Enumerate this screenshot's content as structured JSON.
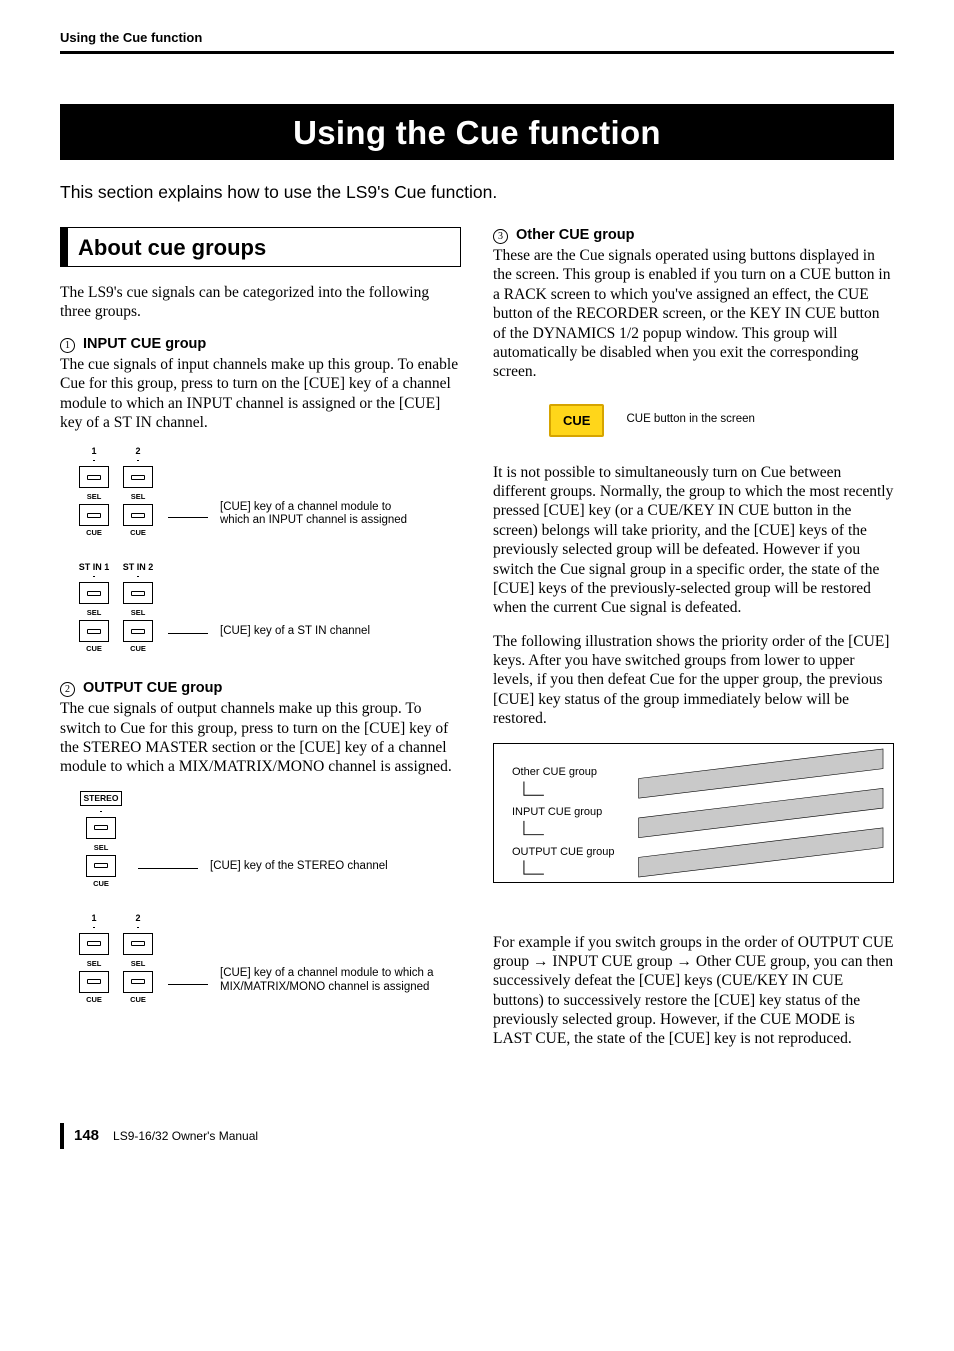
{
  "running_head": "Using the Cue function",
  "title": "Using the Cue function",
  "intro": "This section explains how to use the LS9's Cue function.",
  "section_heading": "About cue groups",
  "lead_para": "The LS9's cue signals can be categorized into the following three groups.",
  "groups": {
    "g1": {
      "num": "1",
      "heading": "INPUT CUE group",
      "para": "The cue signals of input channels make up this group. To enable Cue for this group, press to turn on the [CUE] key of a channel module to which an INPUT channel is assigned or the [CUE] key of a ST IN channel."
    },
    "g2": {
      "num": "2",
      "heading": "OUTPUT CUE group",
      "para": "The cue signals of output channels make up this group. To switch to Cue for this group, press to turn on the [CUE] key of the STEREO MASTER section or the [CUE] key of a channel module to which a MIX/MATRIX/MONO channel is assigned."
    },
    "g3": {
      "num": "3",
      "heading": "Other CUE group",
      "para": "These are the Cue signals operated using buttons displayed in the screen. This group is enabled if you turn on a CUE button in a RACK screen to which you've assigned an effect, the CUE button of the RECORDER screen, or the KEY IN CUE button of the DYNAMICS 1/2 popup window. This group will automatically be disabled when you exit the corresponding screen."
    }
  },
  "diagrams": {
    "input_numbers": {
      "a": "1",
      "b": "2"
    },
    "stin_labels": {
      "a": "ST IN 1",
      "b": "ST IN 2"
    },
    "stereo_label": "STEREO",
    "mix_numbers": {
      "a": "1",
      "b": "2"
    },
    "sel_label": "SEL",
    "cue_label": "CUE",
    "callouts": {
      "input_mod": "[CUE] key of a channel module to which an INPUT channel is assigned",
      "stin": "[CUE] key of a ST IN channel",
      "stereo": "[CUE] key of the STEREO channel",
      "mix": "[CUE] key of a channel module to which a MIX/MATRIX/MONO channel is assigned"
    }
  },
  "cue_btn": {
    "label": "CUE",
    "callout": "CUE button in the screen"
  },
  "right_para_1": "It is not possible to simultaneously turn on Cue between different groups. Normally, the group to which the most recently pressed [CUE] key (or a CUE/KEY IN CUE button in the screen) belongs will take priority, and the [CUE] keys of the previously selected group will be defeated. However if you switch the Cue signal group in a specific order, the state of the [CUE] keys of the previously-selected group will be restored when the current Cue signal is defeated.",
  "right_para_2": "The following illustration shows the priority order of the [CUE] keys. After you have switched groups from lower to upper levels, if you then defeat Cue for the upper group, the previous [CUE] key status of the group immediately below will be restored.",
  "priority": {
    "top": "Other CUE group",
    "mid": "INPUT CUE group",
    "bot": "OUTPUT CUE group"
  },
  "right_para_3": "For example if you switch groups in the order of OUTPUT CUE group → INPUT CUE group → Other CUE group, you can then successively defeat the [CUE] keys (CUE/KEY IN CUE buttons) to successively restore the [CUE] key status of the previously selected group. However, if the CUE MODE is LAST CUE, the state of the [CUE] key is not reproduced.",
  "footer": {
    "page": "148",
    "doc": "LS9-16/32  Owner's Manual"
  }
}
